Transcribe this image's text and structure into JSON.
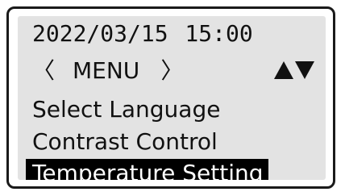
{
  "display": {
    "datetime": "2022/03/15  15:00",
    "menu": {
      "left_bracket": "〈",
      "title": "MENU",
      "right_bracket": "〉",
      "scroll_indicator": "up-down-triangle-icons"
    },
    "items": [
      {
        "label": "Select Language",
        "selected": false
      },
      {
        "label": "Contrast Control",
        "selected": false
      },
      {
        "label": "Temperature Setting",
        "selected": true
      }
    ]
  },
  "colors": {
    "screen_background": "#e3e3e3",
    "text": "#111111",
    "highlight_background": "#000000",
    "highlight_text": "#ffffff",
    "bezel": "#1a1a1a"
  }
}
